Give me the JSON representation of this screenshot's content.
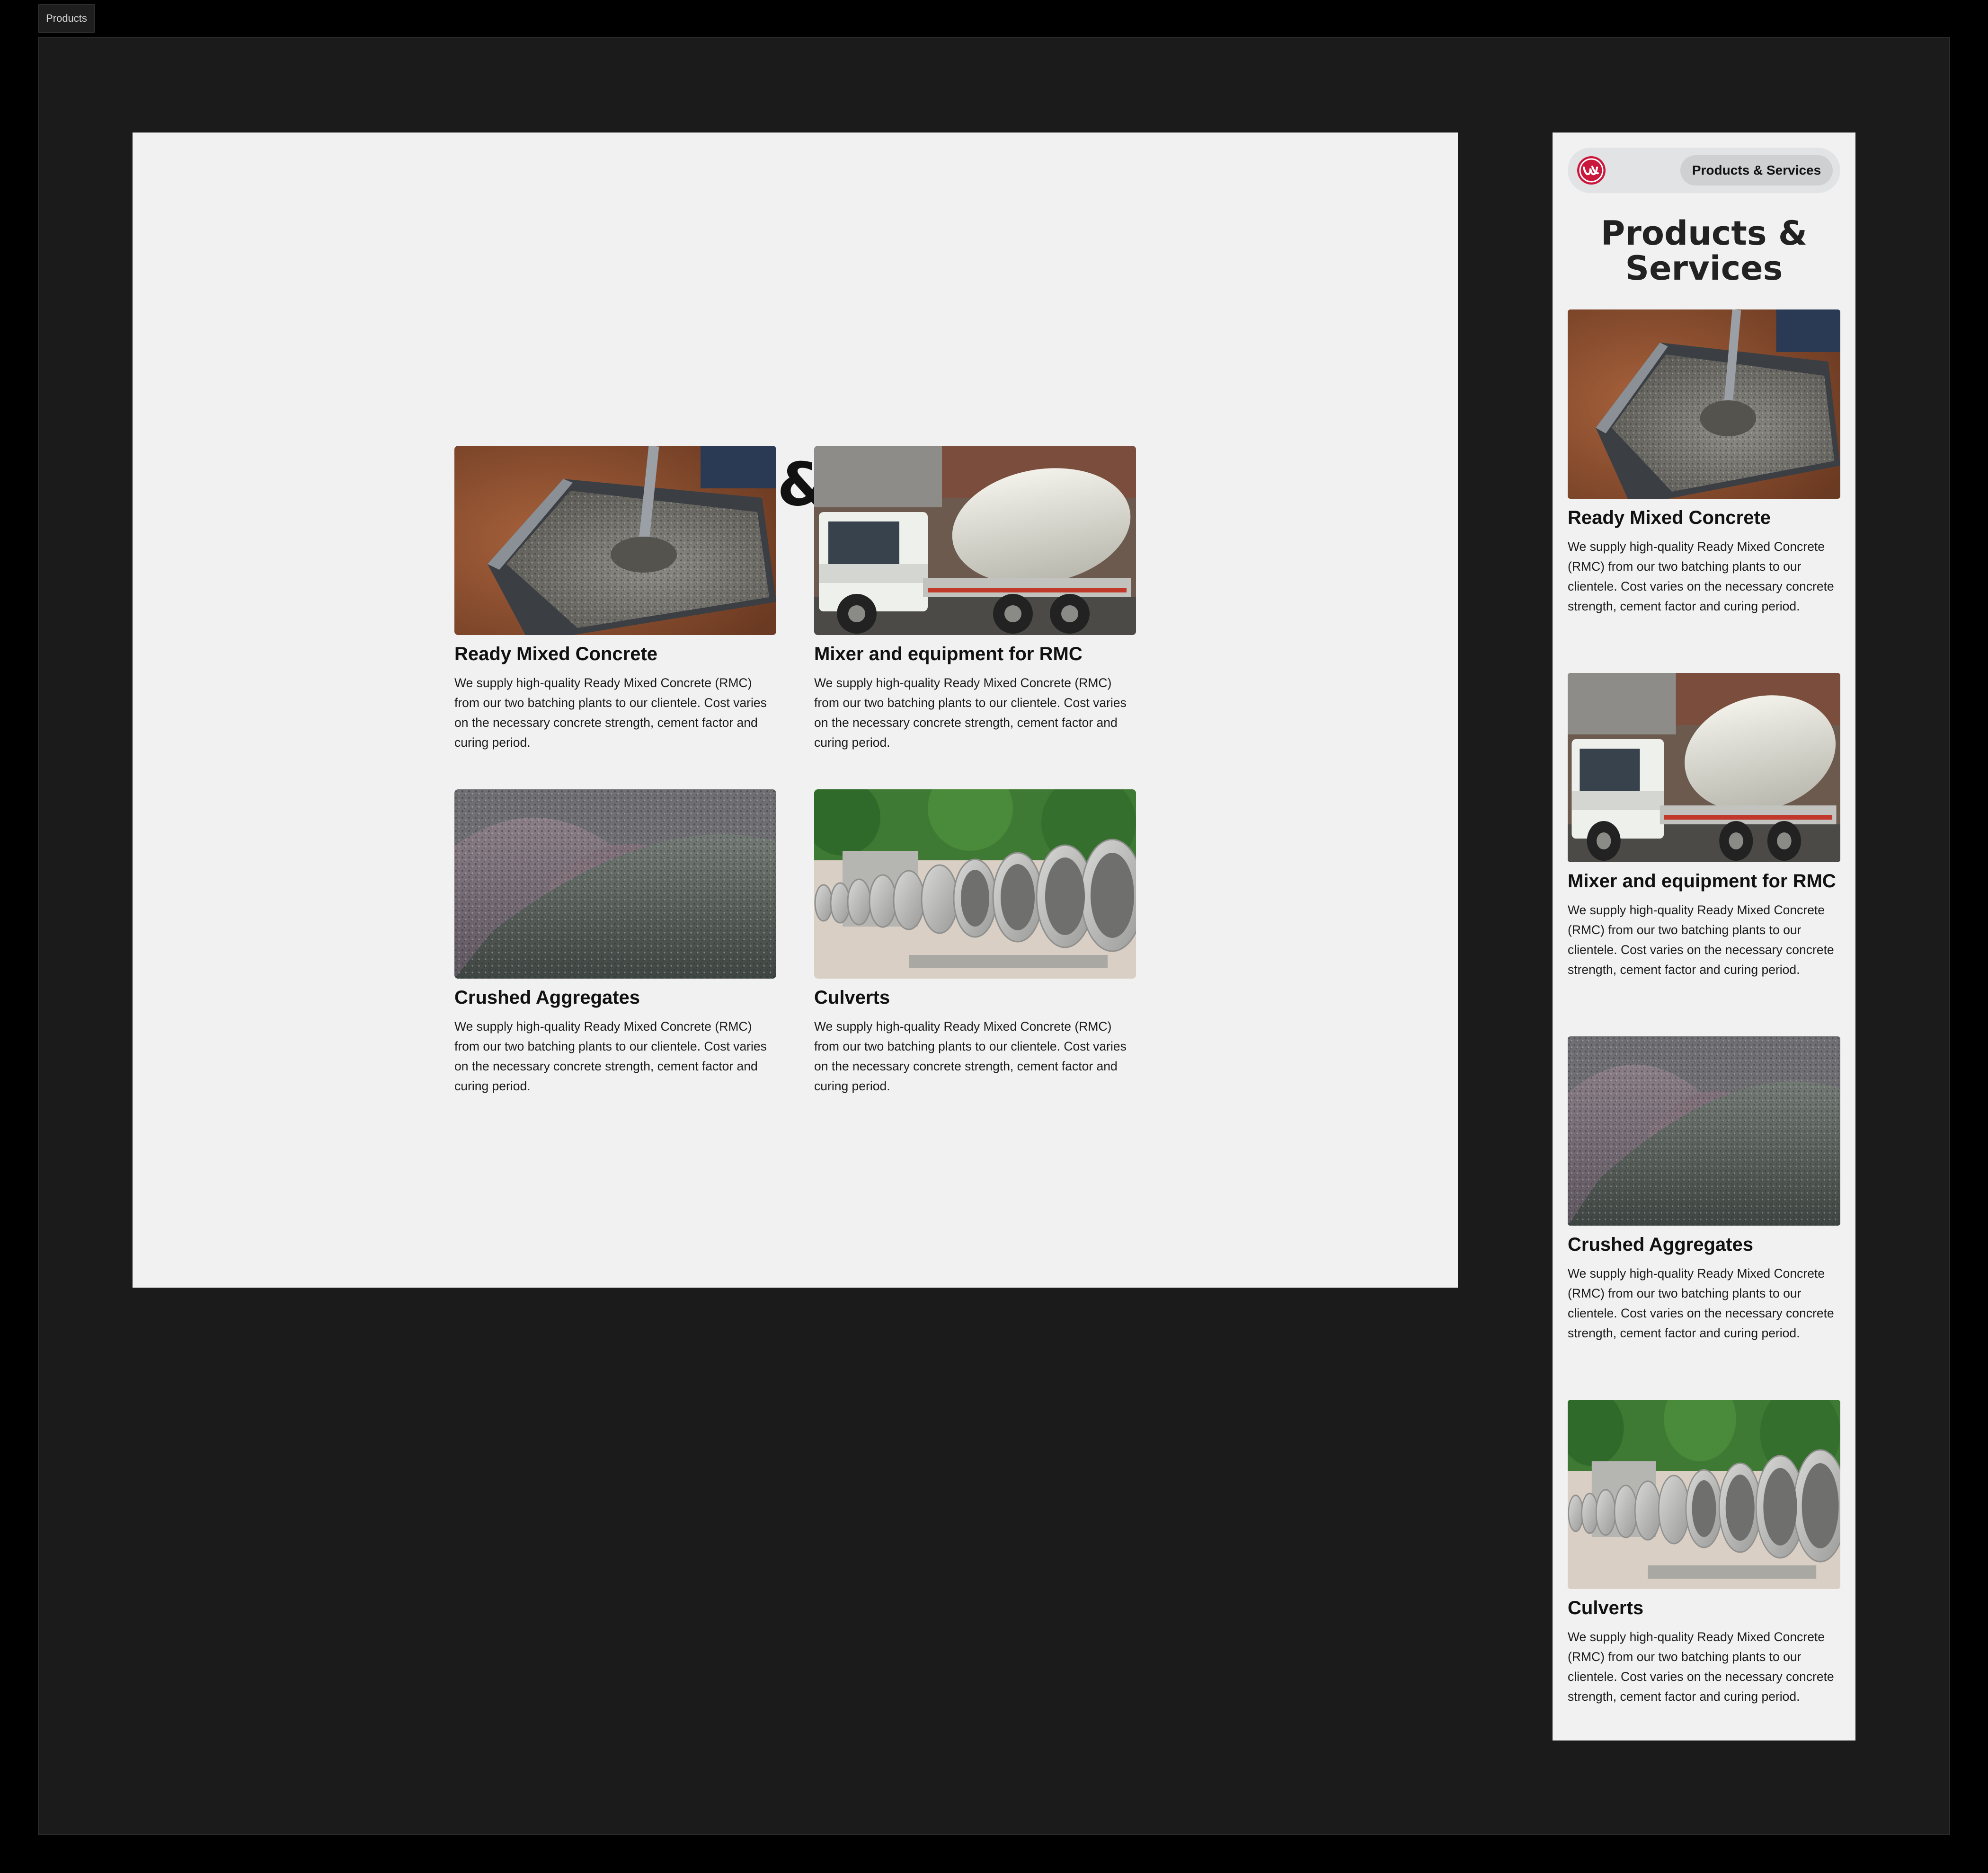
{
  "frame": {
    "tab_label": "Products"
  },
  "page": {
    "title": "Products & Services"
  },
  "mobile": {
    "nav_button_label": "Products & Services",
    "title": "Products & Services"
  },
  "products": [
    {
      "name": "Ready Mixed Concrete",
      "description": "We supply high-quality Ready Mixed Concrete (RMC) from our two batching plants to our clientele. Cost varies on the necessary concrete strength, cement factor and curing period.",
      "image": "wheelbarrow-concrete-photo"
    },
    {
      "name": "Mixer and equipment for RMC",
      "description": "We supply high-quality Ready Mixed Concrete (RMC) from our two batching plants to our clientele. Cost varies on the necessary concrete strength, cement factor and curing period.",
      "image": "mixer-truck-photo"
    },
    {
      "name": "Crushed Aggregates",
      "description": "We supply high-quality Ready Mixed Concrete (RMC) from our two batching plants to our clientele. Cost varies on the necessary concrete strength, cement factor and curing period.",
      "image": "aggregate-piles-photo"
    },
    {
      "name": "Culverts",
      "description": "We supply high-quality Ready Mixed Concrete (RMC) from our two batching plants to our clientele. Cost varies on the necessary concrete strength, cement factor and curing period.",
      "image": "concrete-culverts-photo"
    }
  ],
  "colors": {
    "page_background": "#f1f1f1",
    "canvas_background": "#1c1b1c",
    "logo_red": "#c9183c",
    "nav_pill": "#cfd0d2"
  }
}
